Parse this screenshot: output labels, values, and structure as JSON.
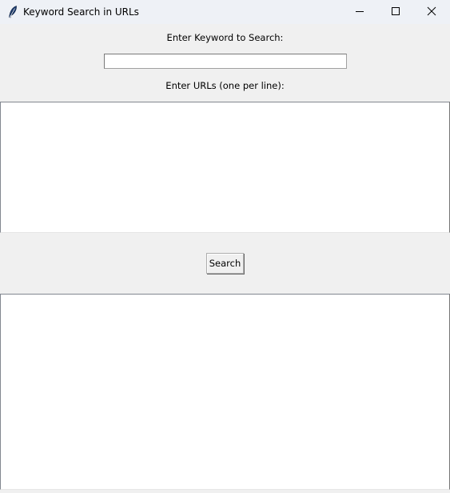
{
  "window": {
    "title": "Keyword Search in URLs",
    "icon": "feather-icon",
    "controls": [
      "minimize-icon",
      "maximize-icon",
      "close-icon"
    ]
  },
  "form": {
    "keyword_label": "Enter Keyword to Search:",
    "keyword_value": "",
    "urls_label": "Enter URLs (one per line):",
    "urls_value": "",
    "search_button_label": "Search",
    "results_value": ""
  },
  "colors": {
    "titlebar": "#eef1f6",
    "window_bg": "#f0f0f0",
    "field_bg": "#ffffff",
    "field_border": "#828790",
    "button_border": "#adadad"
  }
}
